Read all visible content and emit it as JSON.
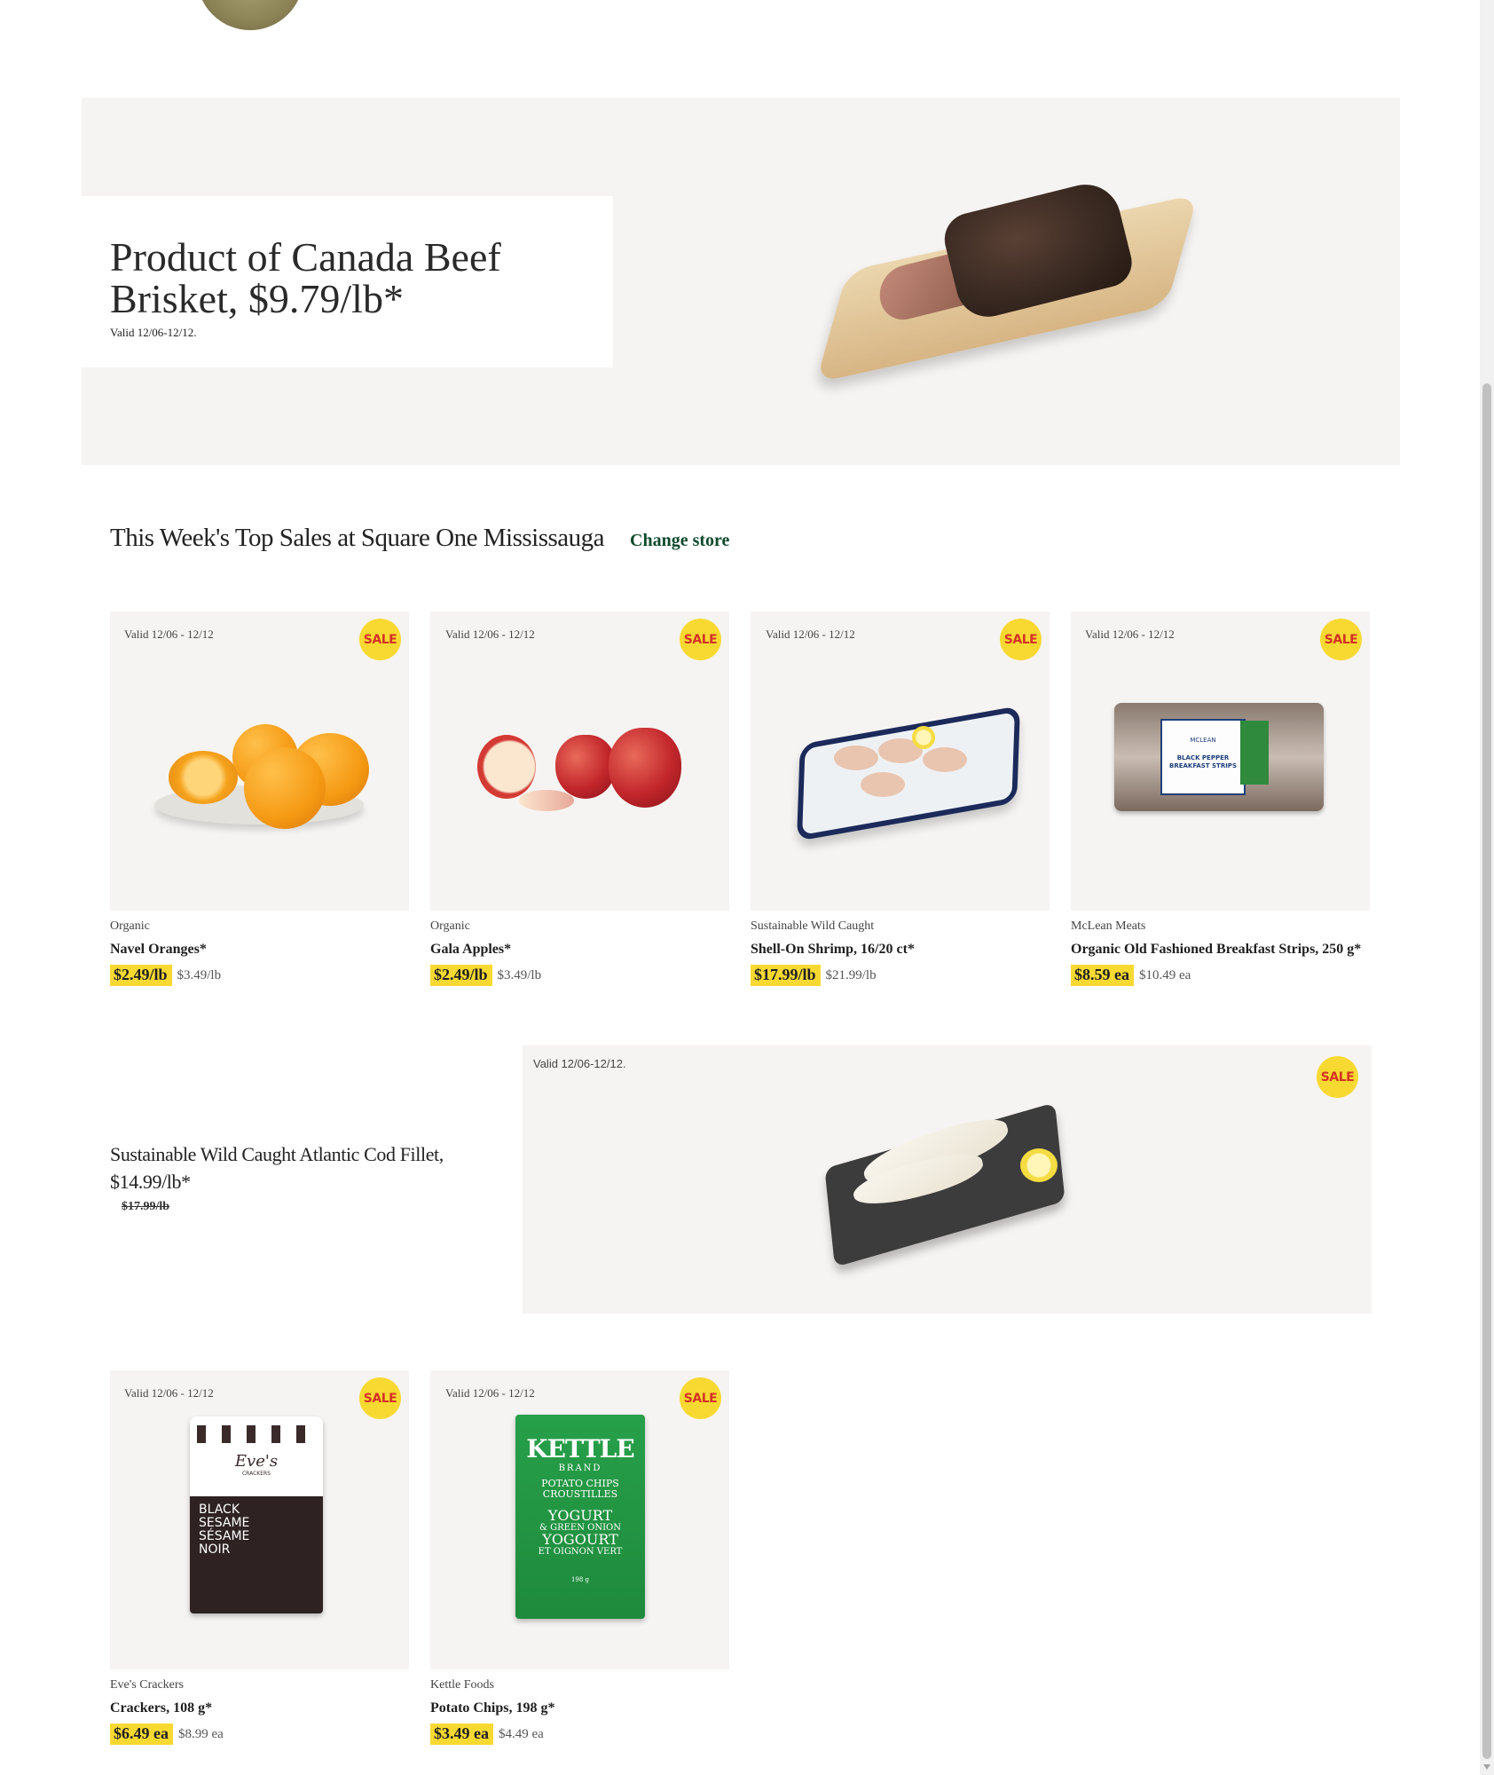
{
  "hero": {
    "title": "Product of Canada Beef Brisket, $9.79/lb*",
    "valid": "Valid 12/06-12/12."
  },
  "section": {
    "title": "This Week's Top Sales at Square One Mississauga",
    "change_store": "Change store"
  },
  "sale_badge": "SALE",
  "products": [
    {
      "valid": "Valid 12/06 - 12/12",
      "brand": "Organic",
      "name": "Navel Oranges*",
      "sale_price": "$2.49/lb",
      "regular_price": "$3.49/lb",
      "image": "oranges"
    },
    {
      "valid": "Valid 12/06 - 12/12",
      "brand": "Organic",
      "name": "Gala Apples*",
      "sale_price": "$2.49/lb",
      "regular_price": "$3.49/lb",
      "image": "apples"
    },
    {
      "valid": "Valid 12/06 - 12/12",
      "brand": "Sustainable Wild Caught",
      "name": "Shell-On Shrimp, 16/20 ct*",
      "sale_price": "$17.99/lb",
      "regular_price": "$21.99/lb",
      "image": "shrimp"
    },
    {
      "valid": "Valid 12/06 - 12/12",
      "brand": "McLean Meats",
      "name": "Organic Old Fashioned Breakfast Strips, 250 g*",
      "sale_price": "$8.59 ea",
      "regular_price": "$10.49 ea",
      "image": "bacon"
    },
    {
      "valid": "Valid 12/06 - 12/12",
      "brand": "Eve's Crackers",
      "name": "Crackers, 108 g*",
      "sale_price": "$6.49 ea",
      "regular_price": "$8.99 ea",
      "image": "crackers"
    },
    {
      "valid": "Valid 12/06 - 12/12",
      "brand": "Kettle Foods",
      "name": "Potato Chips, 198 g*",
      "sale_price": "$3.49 ea",
      "regular_price": "$4.49 ea",
      "image": "chips"
    }
  ],
  "feature": {
    "title": "Sustainable Wild Caught Atlantic Cod Fillet, $14.99/lb*",
    "was_price": "$17.99/lb",
    "valid": "Valid 12/06-12/12."
  },
  "packaging": {
    "bacon": {
      "line1": "BLACK PEPPER",
      "line2": "BREAKFAST STRIPS",
      "brand": "MCLEAN"
    },
    "crackers": {
      "brand": "Eve's",
      "sub": "CRACKERS",
      "line1": "BLACK",
      "line2": "SESAME",
      "line3": "SÉSAME",
      "line4": "NOIR"
    },
    "chips": {
      "brand": "KETTLE",
      "brand_sub": "BRAND",
      "line1": "POTATO CHIPS",
      "line2": "CROUSTILLES",
      "flavour1": "YOGURT",
      "flavour2": "& GREEN ONION",
      "flavour3": "YOGOURT",
      "flavour4": "ET OIGNON VERT",
      "weight": "198 g"
    }
  }
}
